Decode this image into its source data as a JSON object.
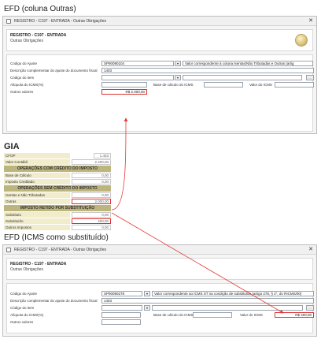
{
  "efd_outras": {
    "section_title": "EFD (coluna Outras)",
    "window_title": "REGISTRO - C197 - ENTRADA - Outras Obrigações",
    "close_glyph": "✕",
    "header": {
      "registro": "REGISTRO - C197 - ENTRADA",
      "subtitle": "Outras Obrigações"
    },
    "fields": {
      "codigo_ajuste_label": "Código do Ajuste",
      "codigo_ajuste_value": "SP90090104",
      "codigo_ajuste_desc": "Valor correspondente à coluna Isentas/Não Tributadas e Outras (artig",
      "descricao_label": "Descrição complementar do ajuste do documento fiscal",
      "descricao_value": "1403",
      "codigo_item_label": "Código do item",
      "codigo_item_value": "",
      "aliquota_label": "Alíquota do ICMS(%)",
      "aliquota_value": "",
      "base_calculo_label": "Base de cálculo do ICMS",
      "base_calculo_value": "",
      "valor_icms_label": "Valor do ICMS",
      "valor_icms_value": "",
      "outros_valores_label": "Outros valores",
      "outros_valores_value": "R$ 2.000,00"
    }
  },
  "gia": {
    "title": "GIA",
    "rows_top": [
      {
        "label": "CFOP",
        "value": "1.403"
      },
      {
        "label": "Valor Contábil",
        "value": "2.400,00"
      }
    ],
    "header_com_credito": "OPERAÇÕES COM CRÉDITO DO IMPOSTO",
    "rows_com_credito": [
      {
        "label": "Base de Cálculo",
        "value": "0,00"
      },
      {
        "label": "Imposto Creditado",
        "value": "0,00"
      }
    ],
    "header_sem_credito": "OPERAÇÕES SEM CRÉDITO DO IMPOSTO",
    "rows_sem_credito": [
      {
        "label": "Isentas e Não Tributadas",
        "value": "0,00"
      },
      {
        "label": "Outras",
        "value": "2.000,00"
      }
    ],
    "header_retido": "IMPOSTO RETIDO POR SUBSTITUIÇÃO",
    "rows_retido": [
      {
        "label": "Substituto",
        "value": "0,00"
      },
      {
        "label": "Substituído",
        "value": "400,00"
      },
      {
        "label": "Outros Impostos",
        "value": "0,00"
      }
    ]
  },
  "efd_substituido": {
    "section_title": "EFD (ICMS como substituído)",
    "window_title": "REGISTRO - C197 - ENTRADA - Outras Obrigações",
    "close_glyph": "✕",
    "header": {
      "registro": "REGISTRO - C197 - ENTRADA",
      "subtitle": "Outras Obrigações"
    },
    "fields": {
      "codigo_ajuste_label": "Código do Ajuste",
      "codigo_ajuste_value": "SP90090278",
      "codigo_ajuste_desc": "Valor correspondente ao ICMS ST na condição de substituído (artigo 278, § 1º, do RICMS/00)",
      "descricao_label": "Descrição complementar do ajuste do documento fiscal",
      "descricao_value": "1403",
      "codigo_item_label": "Código do item",
      "codigo_item_value": "",
      "aliquota_label": "Alíquota do ICMS(%)",
      "aliquota_value": "",
      "base_calculo_label": "Base de cálculo do ICMS",
      "base_calculo_value": "",
      "valor_icms_label": "Valor do ICMS",
      "valor_icms_value": "R$ 400,00",
      "outros_valores_label": "Outros valores",
      "outros_valores_value": ""
    }
  },
  "colors": {
    "gia_header": "#bdb57e",
    "gia_label_bg": "#f1eccb",
    "arrow": "#e53935"
  }
}
